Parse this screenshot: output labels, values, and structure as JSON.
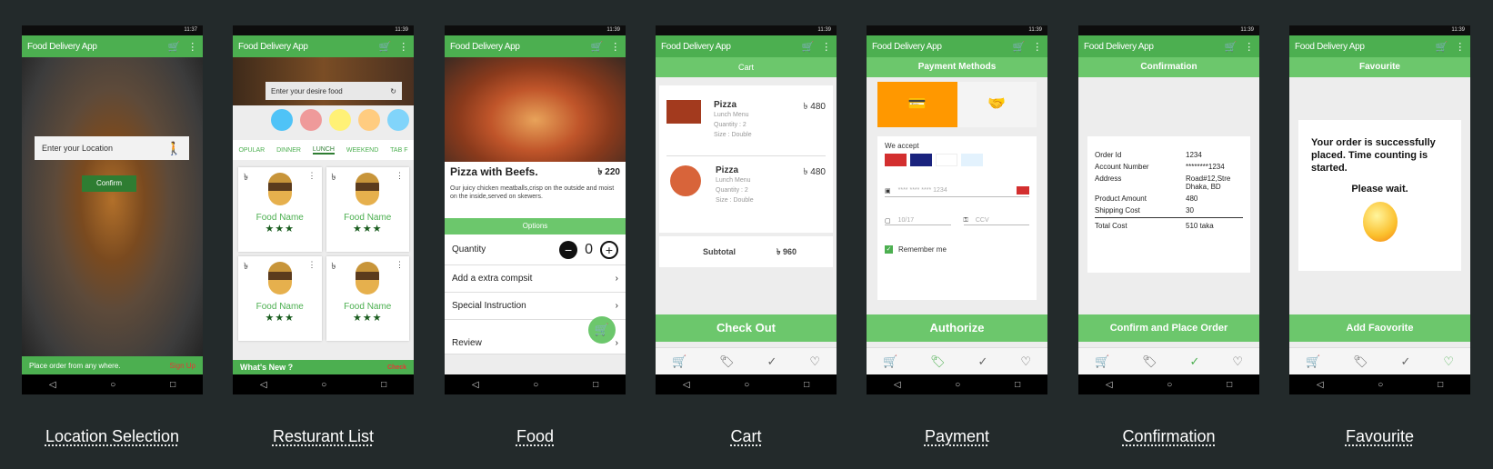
{
  "app_title": "Food Delivery App",
  "nav": {
    "back": "◁",
    "home": "○",
    "recent": "□"
  },
  "screens": {
    "location": {
      "time": "11:37",
      "input_placeholder": "Enter your Location",
      "confirm": "Confirm",
      "footer_text": "Place order from any where.",
      "signup": "Sign Up",
      "caption": "Location Selection"
    },
    "restaurant": {
      "time": "11:39",
      "search_placeholder": "Enter your desire food",
      "tabs": [
        "OPULAR",
        "DINNER",
        "LUNCH",
        "WEEKEND",
        "TAB F"
      ],
      "active_tab": "LUNCH",
      "currency": "৳",
      "food_name": "Food Name",
      "whats_new": "What's New ?",
      "check": "Check",
      "caption": "Resturant List"
    },
    "food": {
      "time": "11:39",
      "title": "Pizza with Beefs.",
      "price": "৳ 220",
      "description": "Our juicy chicken meatballs,crisp on the outside and moist on the inside,served on skewers.",
      "options": "Options",
      "quantity_label": "Quantity",
      "quantity": "0",
      "extra": "Add a extra compsit",
      "special": "Special Instruction",
      "review": "Review",
      "caption": "Food"
    },
    "cart": {
      "time": "11:39",
      "header": "Cart",
      "items": [
        {
          "name": "Pizza",
          "price": "৳ 480",
          "menu": "Lunch Menu",
          "qty": "Quantity : 2",
          "size": "Size : Double"
        },
        {
          "name": "Pizza",
          "price": "৳ 480",
          "menu": "Lunch Menu",
          "qty": "Quantity : 2",
          "size": "Size : Double"
        }
      ],
      "subtotal_label": "Subtotal",
      "subtotal": "৳ 960",
      "checkout": "Check Out",
      "caption": "Cart"
    },
    "payment": {
      "time": "11:39",
      "header": "Payment Methods",
      "we_accept": "We accept",
      "card_number": "**** **** **** 1234",
      "expiry": "10/17",
      "ccv": "CCV",
      "remember": "Remember me",
      "authorize": "Authorize",
      "caption": "Payment"
    },
    "confirmation": {
      "time": "11:39",
      "header": "Confirmation",
      "rows": [
        {
          "k": "Order Id",
          "v": "1234"
        },
        {
          "k": "Account Number",
          "v": "********1234"
        },
        {
          "k": "Address",
          "v": "Road#12,Stre Dhaka, BD"
        },
        {
          "k": "Product Amount",
          "v": "480"
        },
        {
          "k": "Shipping Cost",
          "v": "30"
        }
      ],
      "total_label": "Total Cost",
      "total": "510 taka",
      "confirm": "Confirm and Place Order",
      "caption": "Confirmation"
    },
    "favourite": {
      "time": "11:39",
      "header": "Favourite",
      "message": "Your order is successfully placed. Time counting is started.",
      "wait": "Please wait.",
      "add": "Add Faovorite",
      "caption": "Favourite"
    }
  },
  "colors": {
    "primary": "#4caf50",
    "light": "#6cc76c",
    "orange": "#ff9800",
    "bg": "#232a2b"
  },
  "tab_icons": [
    "cart-icon",
    "tag-icon",
    "check-icon",
    "heart-icon"
  ]
}
